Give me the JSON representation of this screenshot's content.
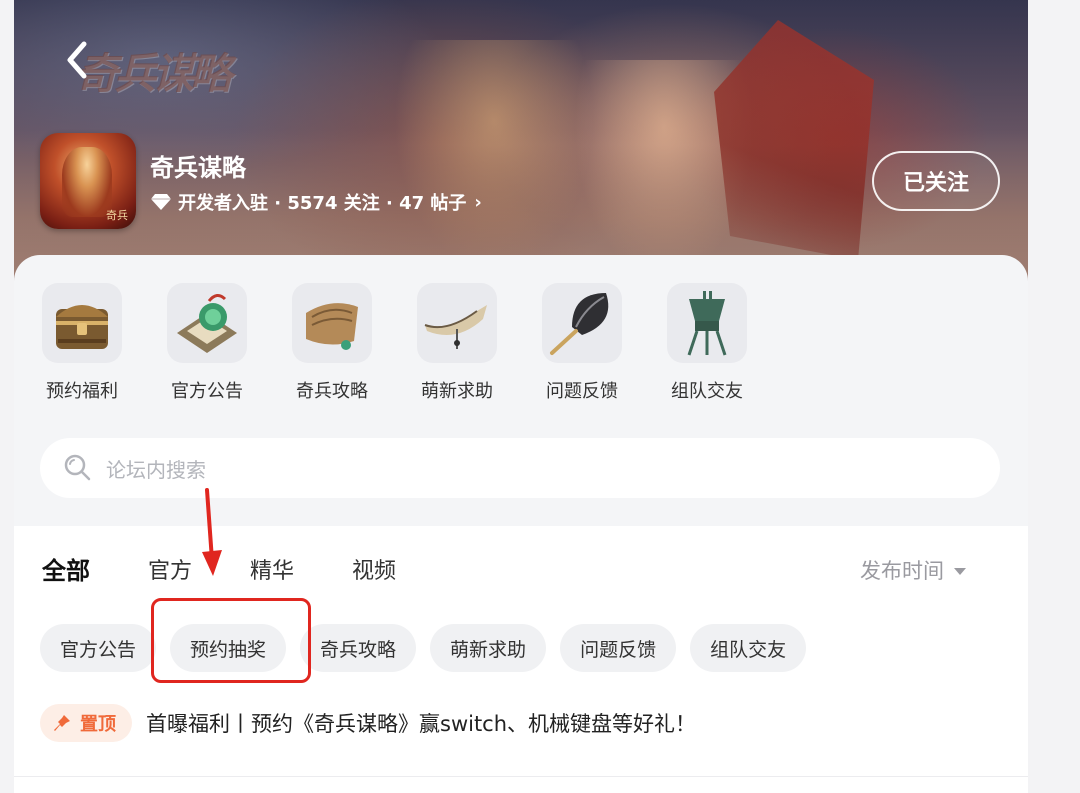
{
  "header": {
    "logo_text": "奇兵谋略",
    "game_name": "奇兵谋略",
    "meta": "开发者入驻 · 5574 关注 · 47 帖子",
    "meta_chevron": "›",
    "follow_label": "已关注",
    "icon_mark": "奇兵"
  },
  "shortcuts": [
    {
      "label": "预约福利",
      "icon": "treasure-chest-icon"
    },
    {
      "label": "官方公告",
      "icon": "jade-seal-icon"
    },
    {
      "label": "奇兵攻略",
      "icon": "scroll-icon"
    },
    {
      "label": "萌新求助",
      "icon": "horn-icon"
    },
    {
      "label": "问题反馈",
      "icon": "feather-fan-icon"
    },
    {
      "label": "组队交友",
      "icon": "bronze-goblet-icon"
    }
  ],
  "search": {
    "placeholder": "论坛内搜索"
  },
  "tabs": [
    {
      "label": "全部",
      "active": true
    },
    {
      "label": "官方",
      "active": false
    },
    {
      "label": "精华",
      "active": false
    },
    {
      "label": "视频",
      "active": false
    }
  ],
  "sort": {
    "label": "发布时间"
  },
  "chips": [
    "官方公告",
    "预约抽奖",
    "奇兵攻略",
    "萌新求助",
    "问题反馈",
    "组队交友"
  ],
  "pinned": {
    "badge": "置顶",
    "title": "首曝福利丨预约《奇兵谋略》赢switch、机械键盘等好礼！"
  },
  "colors": {
    "accent_teal": "#5fd0c7",
    "pin_orange": "#f06a3a",
    "annotation_red": "#e0261f"
  }
}
